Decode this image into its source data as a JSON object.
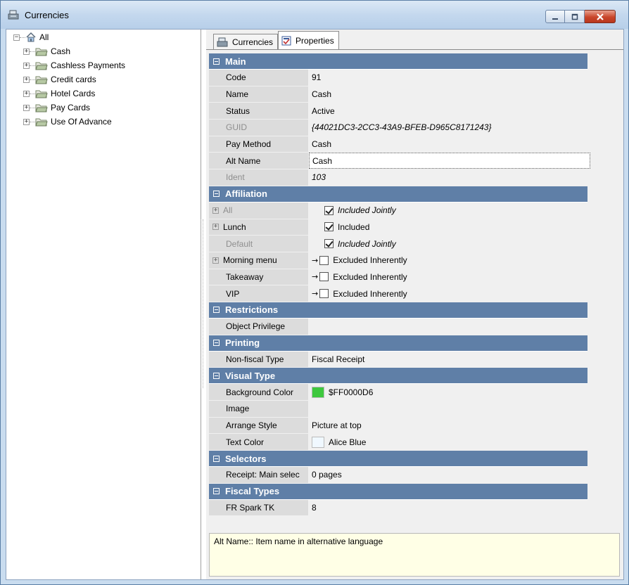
{
  "window": {
    "title": "Currencies",
    "min_icon": "minimize-icon",
    "max_icon": "maximize-icon",
    "close_icon": "close-icon"
  },
  "tree": {
    "root": "All",
    "items": [
      "Cash",
      "Cashless Payments",
      "Credit cards",
      "Hotel Cards",
      "Pay Cards",
      "Use Of Advance"
    ]
  },
  "tabs": [
    {
      "label": "Currencies",
      "icon": "register-icon"
    },
    {
      "label": "Properties",
      "icon": "properties-icon"
    }
  ],
  "properties": {
    "main": {
      "title": "Main",
      "rows": [
        {
          "name": "Code",
          "value": "91"
        },
        {
          "name": "Name",
          "value": "Cash"
        },
        {
          "name": "Status",
          "value": "Active"
        },
        {
          "name": "GUID",
          "value": "{44021DC3-2CC3-43A9-BFEB-D965C8171243}"
        },
        {
          "name": "Pay Method",
          "value": "Cash"
        },
        {
          "name": "Alt Name",
          "value": "Cash"
        },
        {
          "name": "Ident",
          "value": "103"
        }
      ]
    },
    "affiliation": {
      "title": "Affiliation",
      "rows": [
        {
          "name": "All",
          "value": "Included Jointly"
        },
        {
          "name": "Lunch",
          "value": "Included"
        },
        {
          "name": "Default",
          "value": "Included Jointly"
        },
        {
          "name": "Morning menu",
          "value": "Excluded Inherently"
        },
        {
          "name": "Takeaway",
          "value": "Excluded Inherently"
        },
        {
          "name": "VIP",
          "value": "Excluded Inherently"
        }
      ]
    },
    "restrictions": {
      "title": "Restrictions",
      "rows": [
        {
          "name": "Object Privilege",
          "value": ""
        }
      ]
    },
    "printing": {
      "title": "Printing",
      "rows": [
        {
          "name": "Non-fiscal Type",
          "value": "Fiscal Receipt"
        }
      ]
    },
    "visual": {
      "title": "Visual Type",
      "rows": [
        {
          "name": "Background Color",
          "value": "$FF0000D6",
          "color": "#3ec83e"
        },
        {
          "name": "Image",
          "value": ""
        },
        {
          "name": "Arrange Style",
          "value": "Picture at top"
        },
        {
          "name": "Text Color",
          "value": "Alice Blue",
          "color": "#f0f8ff"
        }
      ]
    },
    "selectors": {
      "title": "Selectors",
      "rows": [
        {
          "name": "Receipt: Main selec",
          "value": "0 pages"
        }
      ]
    },
    "fiscal": {
      "title": "Fiscal Types",
      "rows": [
        {
          "name": "FR Spark TK",
          "value": "8"
        }
      ]
    }
  },
  "description": "Alt Name:: Item name in alternative language"
}
